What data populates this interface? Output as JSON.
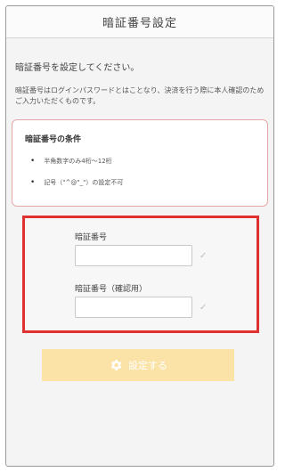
{
  "header": {
    "title": "暗証番号設定"
  },
  "intro": {
    "heading": "暗証番号を設定してください。",
    "description": "暗証番号はログインパスワードとはことなり、決済を行う際に本人確認のためご入力いただくものです。"
  },
  "conditions": {
    "title": "暗証番号の条件",
    "items": [
      "半角数字のみ4桁〜12桁",
      "記号（\"^@\"_\"）の設定不可"
    ]
  },
  "form": {
    "pin_label": "暗証番号",
    "pin_value": "",
    "pin_confirm_label": "暗証番号（確認用）",
    "pin_confirm_value": ""
  },
  "submit": {
    "label": "設定する",
    "icon": "gear-icon"
  },
  "colors": {
    "highlight": "#e03131",
    "condition_border": "#e7a6a6",
    "button": "#fbe3a8"
  }
}
